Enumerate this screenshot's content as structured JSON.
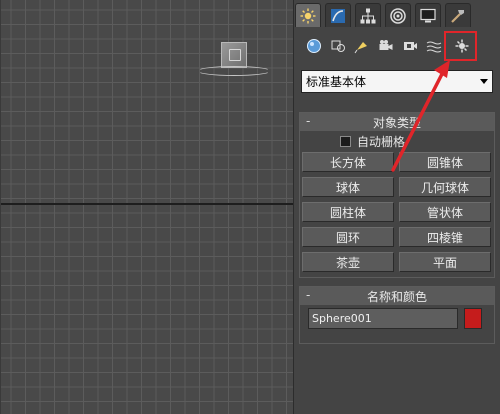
{
  "viewport": {
    "object_label": "",
    "grid": "on"
  },
  "command_panel": {
    "tabs": [
      {
        "name": "create-tab-icon",
        "active": true
      },
      {
        "name": "modify-tab-icon",
        "active": false
      },
      {
        "name": "hierarchy-tab-icon",
        "active": false
      },
      {
        "name": "motion-tab-icon",
        "active": false
      },
      {
        "name": "display-tab-icon",
        "active": false
      },
      {
        "name": "utilities-tab-icon",
        "active": false
      }
    ],
    "subcategories": [
      "geometry-icon",
      "shapes-icon",
      "lights-icon",
      "cameras-icon",
      "helpers-icon",
      "spacewarps-icon",
      "systems-icon"
    ],
    "dropdown": {
      "value": "标准基本体"
    },
    "object_type": {
      "title": "对象类型",
      "collapse_symbol": "-",
      "autogrid_label": "自动栅格",
      "buttons": [
        "长方体",
        "圆锥体",
        "球体",
        "几何球体",
        "圆柱体",
        "管状体",
        "圆环",
        "四棱锥",
        "茶壶",
        "平面"
      ]
    },
    "name_and_color": {
      "title": "名称和颜色",
      "collapse_symbol": "-",
      "name_value": "Sphere001",
      "swatch_color": "#c51c1c"
    }
  },
  "annotation": {
    "highlight_color": "#e0252a"
  }
}
